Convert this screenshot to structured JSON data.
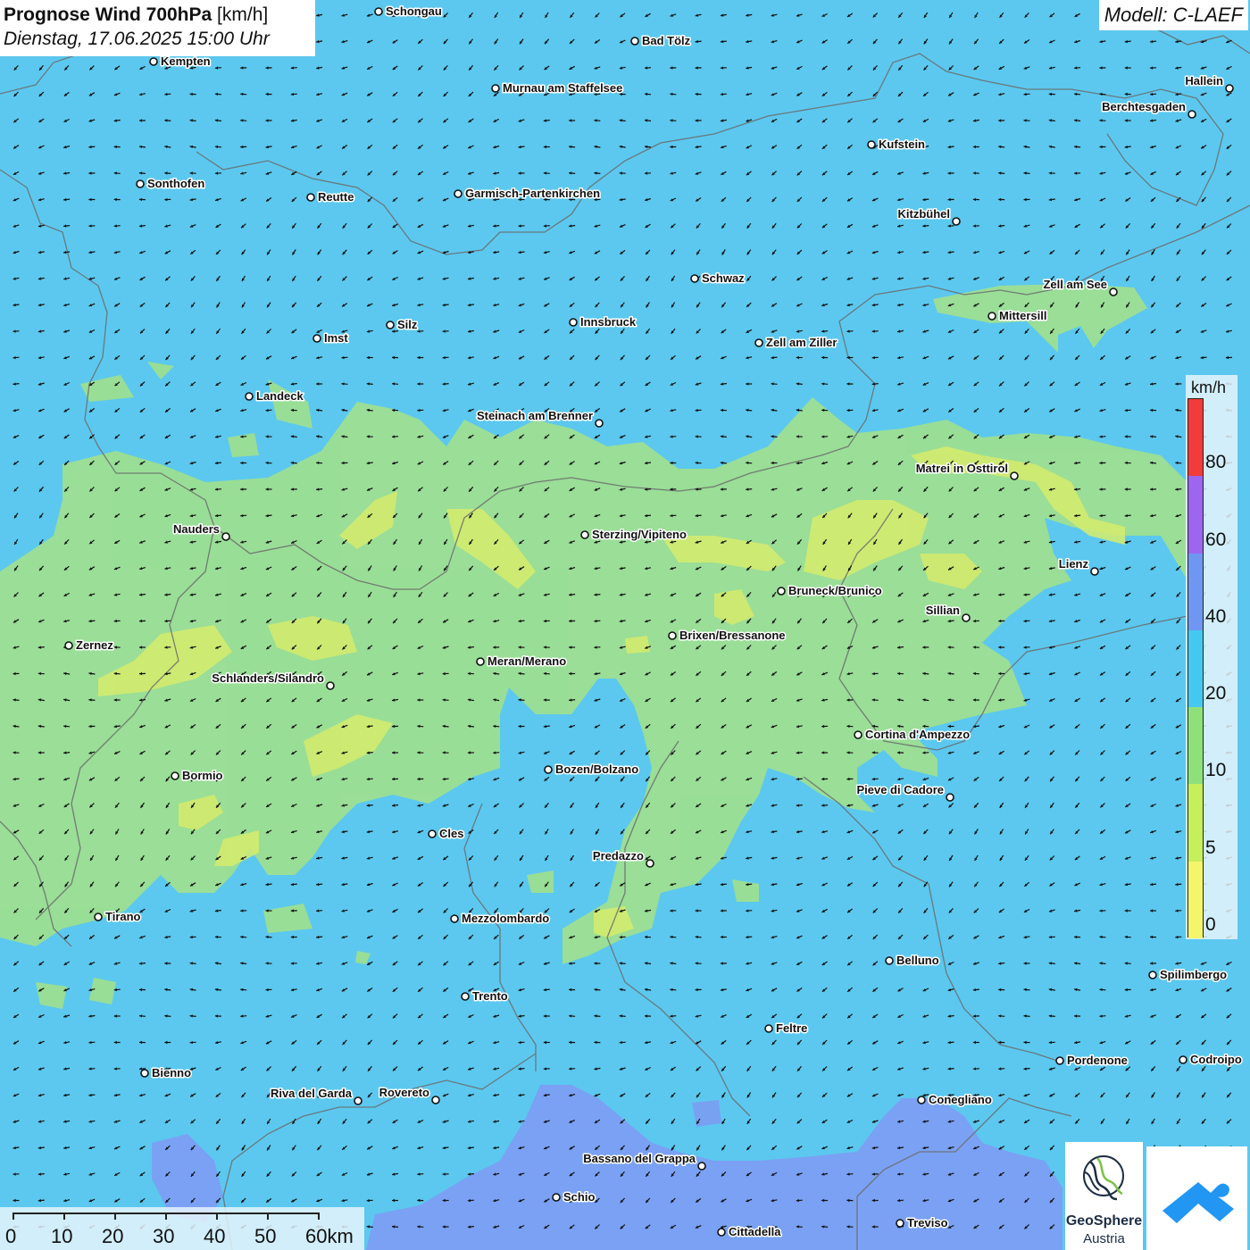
{
  "title": {
    "main_bold": "Prognose Wind 700hPa",
    "unit": "[km/h]",
    "datetime": "Dienstag, 17.06.2025 15:00 Uhr"
  },
  "model_label": "Modell: C-LAEF",
  "legend": {
    "unit": "km/h",
    "ticks": [
      "80",
      "60",
      "40",
      "20",
      "10",
      "5",
      "0"
    ],
    "colors": [
      "#f23b3b",
      "#9c66ef",
      "#6f97f1",
      "#45c8ef",
      "#8ee17a",
      "#c6ef5c",
      "#f5f56a"
    ]
  },
  "scalebar": {
    "labels": [
      "0",
      "10",
      "20",
      "30",
      "40",
      "50",
      "60km"
    ]
  },
  "logos": {
    "geosphere_line1": "GeoSphere",
    "geosphere_line2": "Austria",
    "app_icon": "wind-app-icon"
  },
  "map_colors": {
    "base_speed": "#5cc8ef",
    "low_speed": "#9fe08f",
    "lowest_speed": "#d6ec6c",
    "high_speed": "#7b9ff2",
    "borders": "#6b6b6b",
    "arrows": "#111111"
  },
  "cities": [
    {
      "name": "Schongau"
    },
    {
      "name": "Bad Tölz"
    },
    {
      "name": "Kempten"
    },
    {
      "name": "Murnau am Staffelsee"
    },
    {
      "name": "Hallein"
    },
    {
      "name": "Berchtesgaden"
    },
    {
      "name": "Kufstein"
    },
    {
      "name": "Sonthofen"
    },
    {
      "name": "Reutte"
    },
    {
      "name": "Garmisch-Partenkirchen"
    },
    {
      "name": "Kitzbühel"
    },
    {
      "name": "Schwaz"
    },
    {
      "name": "Zell am See"
    },
    {
      "name": "Mittersill"
    },
    {
      "name": "Innsbruck"
    },
    {
      "name": "Silz"
    },
    {
      "name": "Imst"
    },
    {
      "name": "Zell am Ziller"
    },
    {
      "name": "Landeck"
    },
    {
      "name": "Steinach am Brenner"
    },
    {
      "name": "Matrei in Osttirol"
    },
    {
      "name": "Nauders"
    },
    {
      "name": "Sterzing/Vipiteno"
    },
    {
      "name": "Lienz"
    },
    {
      "name": "Bruneck/Brunico"
    },
    {
      "name": "Sillian"
    },
    {
      "name": "Zernez"
    },
    {
      "name": "Brixen/Bressanone"
    },
    {
      "name": "Meran/Merano"
    },
    {
      "name": "Schlanders/Silandro"
    },
    {
      "name": "Cortina d'Ampezzo"
    },
    {
      "name": "Bozen/Bolzano"
    },
    {
      "name": "Bormio"
    },
    {
      "name": "Pieve di Cadore"
    },
    {
      "name": "Cles"
    },
    {
      "name": "Predazzo"
    },
    {
      "name": "Tirano"
    },
    {
      "name": "Mezzolombardo"
    },
    {
      "name": "Belluno"
    },
    {
      "name": "Spilimbergo"
    },
    {
      "name": "Trento"
    },
    {
      "name": "Feltre"
    },
    {
      "name": "Pordenone"
    },
    {
      "name": "Codroipo"
    },
    {
      "name": "Bienno"
    },
    {
      "name": "Riva del Garda"
    },
    {
      "name": "Rovereto"
    },
    {
      "name": "Conegliano"
    },
    {
      "name": "Bassano del Grappa"
    },
    {
      "name": "Schio"
    },
    {
      "name": "Treviso"
    },
    {
      "name": "Cittadella"
    }
  ]
}
